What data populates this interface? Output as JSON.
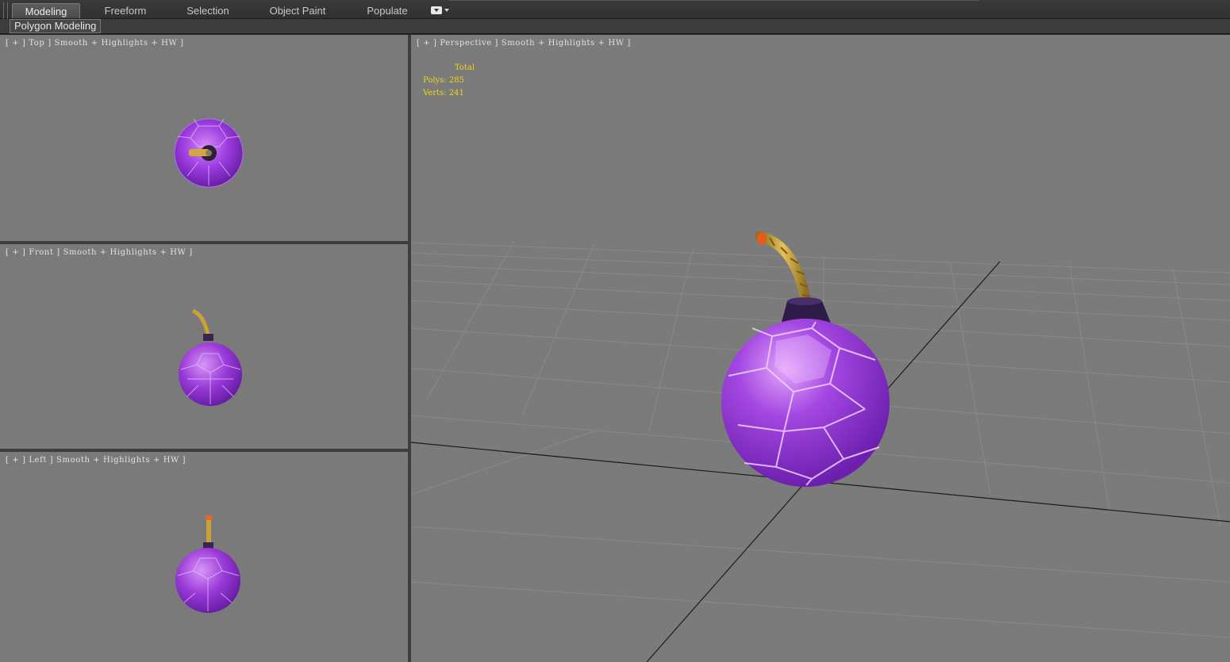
{
  "ribbon": {
    "tabs": [
      {
        "label": "Modeling",
        "active": true
      },
      {
        "label": "Freeform",
        "active": false
      },
      {
        "label": "Selection",
        "active": false
      },
      {
        "label": "Object Paint",
        "active": false
      },
      {
        "label": "Populate",
        "active": false
      }
    ],
    "dropdown_icon": "ribbon-options-icon",
    "panel_label": "Polygon Modeling"
  },
  "viewports": {
    "top": {
      "label": "[ + ] Top ] Smooth + Highlights + HW ]"
    },
    "front": {
      "label": "[ + ] Front ] Smooth + Highlights + HW ]"
    },
    "left": {
      "label": "[ + ] Left ] Smooth + Highlights + HW ]"
    },
    "perspective": {
      "label": "[ + ] Perspective ] Smooth + Highlights + HW ]"
    }
  },
  "stats": {
    "header": "Total",
    "polys_label": "Polys:",
    "polys_value": "285",
    "verts_label": "Verts:",
    "verts_value": "241"
  },
  "colors": {
    "viewport_bg": "#7a7a7a",
    "bomb_purple": "#9a3ad8",
    "fuse_gold": "#c9a23a",
    "stats_yellow": "#f0d21c"
  }
}
